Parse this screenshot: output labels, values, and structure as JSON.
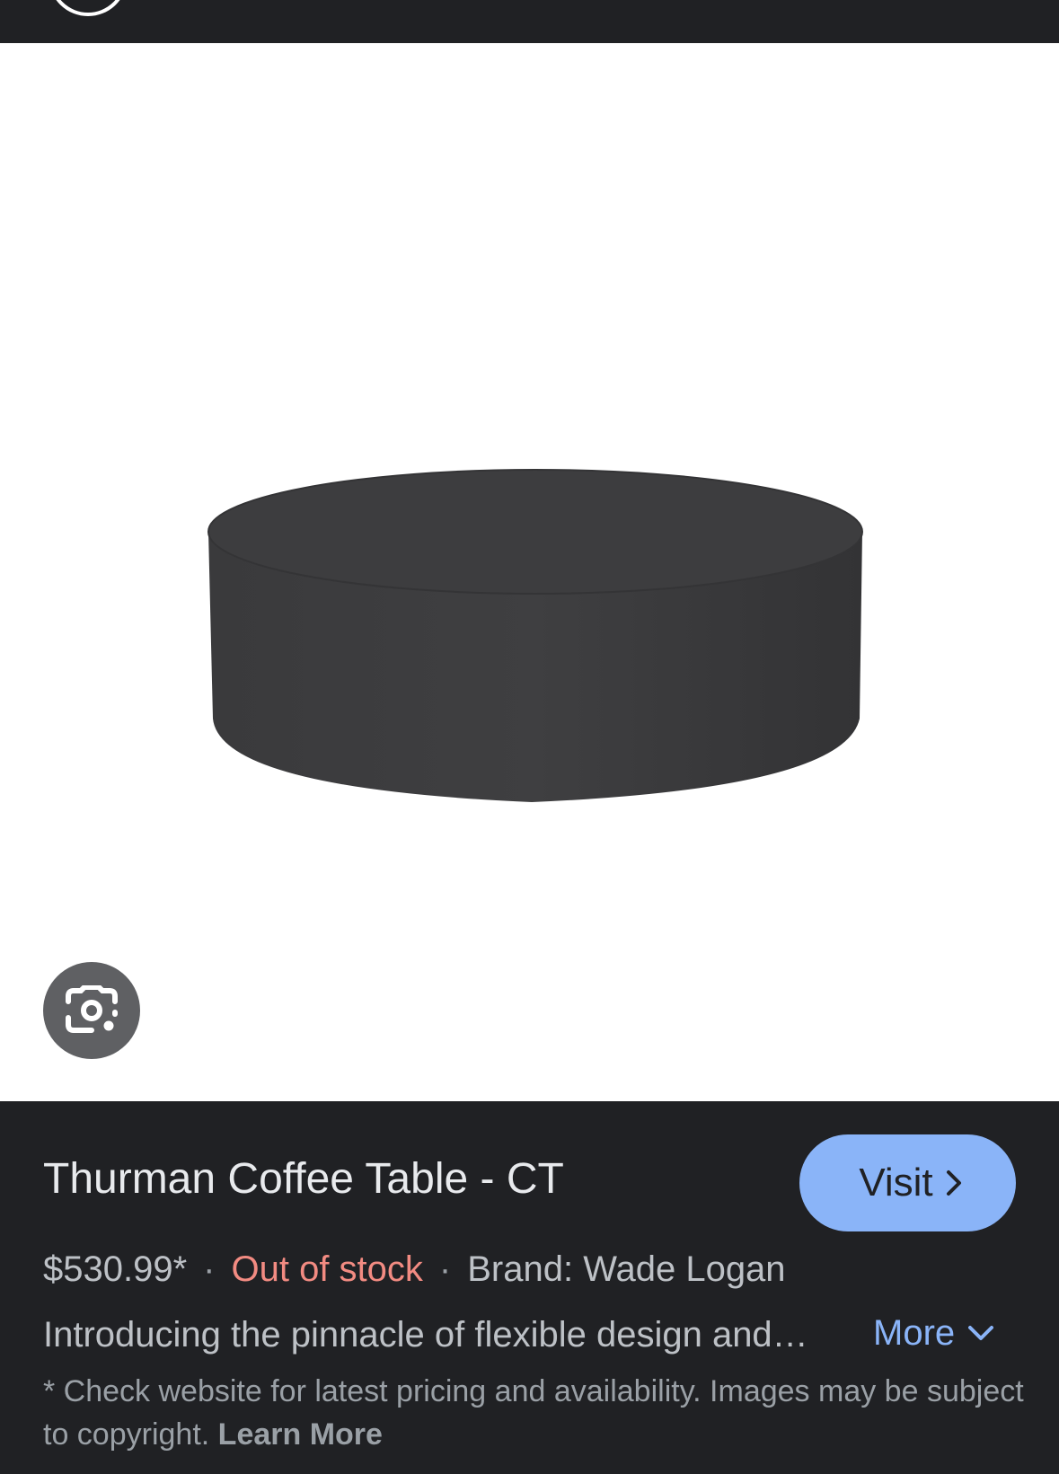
{
  "product": {
    "title": "Thurman Coffee Table - CT",
    "price": "$530.99*",
    "stock_status": "Out of stock",
    "brand": "Brand: Wade Logan",
    "description": "Introducing the pinnacle of flexible design and…",
    "more_label": "More"
  },
  "actions": {
    "visit_label": "Visit"
  },
  "disclaimer": {
    "text": "* Check website for latest pricing and availability. Images may be subject to copyright.",
    "learn_more": "Learn More"
  },
  "separator": "·",
  "icons": {
    "lens": "google-lens-icon",
    "visit_chevron": "chevron-right-icon",
    "more_chevron": "chevron-down-icon"
  },
  "colors": {
    "background": "#202124",
    "accent": "#8ab4f8",
    "stock_alert": "#f28b82",
    "product": "#3c3c3e"
  }
}
